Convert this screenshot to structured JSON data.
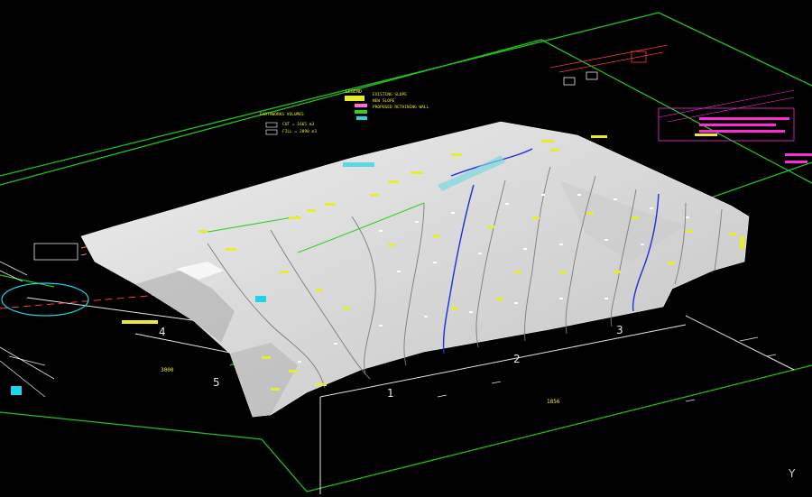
{
  "lot_numbers": [
    "4",
    "5",
    "1",
    "2",
    "3"
  ],
  "legend": {
    "title": "LEGEND",
    "rows": [
      "EXISTING SLOPE",
      "NEW SLOPE",
      "PROPOSED RETAINING WALL"
    ]
  },
  "earthworks": {
    "title": "EARTHWORKS VOLUMES",
    "rows": [
      "CUT = 1665 m3",
      "FILL = 2890 m3"
    ]
  },
  "dims": [
    "3000",
    "1856"
  ],
  "ucs_label": "Y",
  "colors": {
    "background": "#000000",
    "boundary": "#22c21e",
    "surface": "#d6d6d6",
    "contour_major": "#1b2fd6",
    "label": "#e8ec30",
    "note": "#ff2bd6",
    "cyan": "#21d3e6"
  }
}
